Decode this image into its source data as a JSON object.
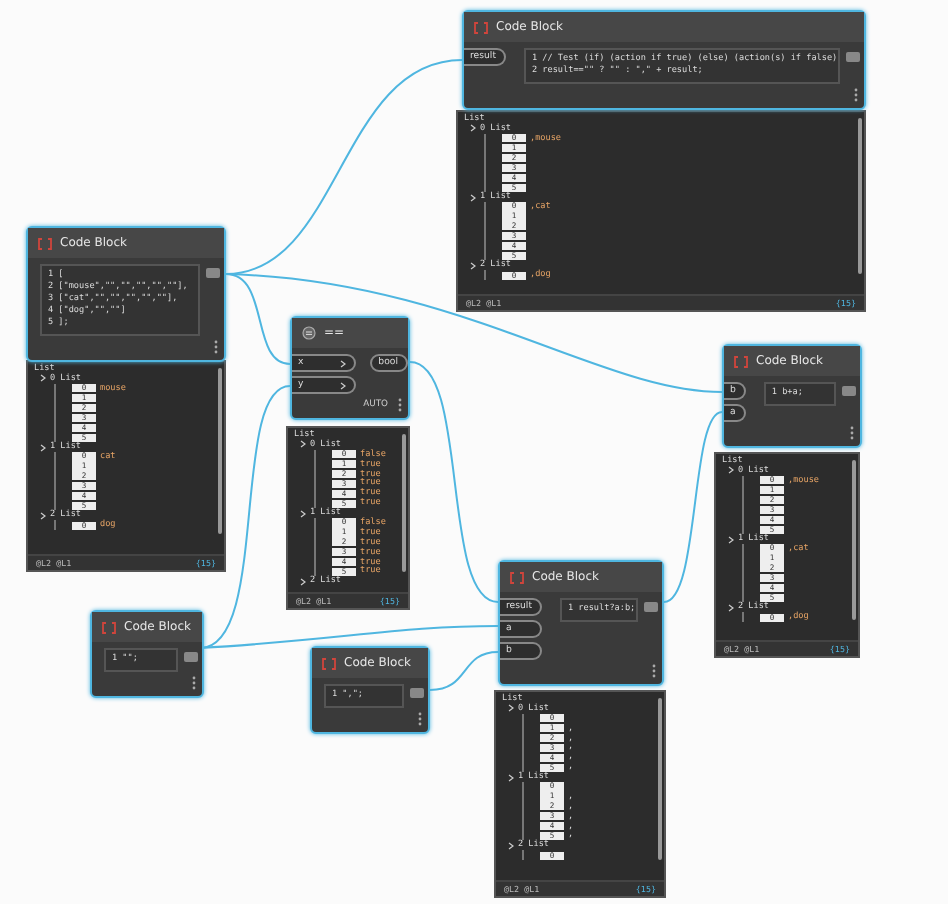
{
  "nodes": [
    {
      "kind": "code",
      "title": "Code Block",
      "selected": true,
      "inputs": [
        "result"
      ],
      "code": [
        "1 // Test (if) (action if true) (else) (action(s) if false)",
        "2 result==\"\" ? \"\" : \",\" + result;"
      ],
      "preview": {
        "header": "List",
        "groups": [
          {
            "label": "0 List",
            "items": [
              {
                "index": "0",
                "value": ",mouse"
              },
              {
                "index": "1",
                "value": ""
              },
              {
                "index": "2",
                "value": ""
              },
              {
                "index": "3",
                "value": ""
              },
              {
                "index": "4",
                "value": ""
              },
              {
                "index": "5",
                "value": ""
              }
            ]
          },
          {
            "label": "1 List",
            "items": [
              {
                "index": "0",
                "value": ",cat"
              },
              {
                "index": "1",
                "value": ""
              },
              {
                "index": "2",
                "value": ""
              },
              {
                "index": "3",
                "value": ""
              },
              {
                "index": "4",
                "value": ""
              },
              {
                "index": "5",
                "value": ""
              }
            ]
          },
          {
            "label": "2 List",
            "items": [
              {
                "index": "0",
                "value": ",dog"
              }
            ]
          }
        ],
        "levels": "@L2 @L1",
        "count": "{15}"
      }
    },
    {
      "kind": "code",
      "title": "Code Block",
      "selected": true,
      "code": [
        "1 [",
        "2 [\"mouse\",\"\",\"\",\"\",\"\",\"\"],",
        "3 [\"cat\",\"\",\"\",\"\",\"\",\"\"],",
        "4 [\"dog\",\"\",\"\"]",
        "5 ];"
      ],
      "preview": {
        "header": "List",
        "groups": [
          {
            "label": "0 List",
            "items": [
              {
                "index": "0",
                "value": "mouse"
              },
              {
                "index": "1",
                "value": ""
              },
              {
                "index": "2",
                "value": ""
              },
              {
                "index": "3",
                "value": ""
              },
              {
                "index": "4",
                "value": ""
              },
              {
                "index": "5",
                "value": ""
              }
            ]
          },
          {
            "label": "1 List",
            "items": [
              {
                "index": "0",
                "value": "cat"
              },
              {
                "index": "1",
                "value": ""
              },
              {
                "index": "2",
                "value": ""
              },
              {
                "index": "3",
                "value": ""
              },
              {
                "index": "4",
                "value": ""
              },
              {
                "index": "5",
                "value": ""
              }
            ]
          },
          {
            "label": "2 List",
            "items": [
              {
                "index": "0",
                "value": "dog"
              }
            ]
          }
        ],
        "levels": "@L2 @L1",
        "count": "{15}"
      }
    },
    {
      "kind": "function",
      "title": "==",
      "selected": true,
      "inputs": [
        "x",
        "y"
      ],
      "output": "bool",
      "lacing": "AUTO",
      "preview": {
        "header": "List",
        "groups": [
          {
            "label": "0 List",
            "items": [
              {
                "index": "0",
                "value": "false"
              },
              {
                "index": "1",
                "value": "true"
              },
              {
                "index": "2",
                "value": "true"
              },
              {
                "index": "3",
                "value": "true"
              },
              {
                "index": "4",
                "value": "true"
              },
              {
                "index": "5",
                "value": "true"
              }
            ]
          },
          {
            "label": "1 List",
            "items": [
              {
                "index": "0",
                "value": "false"
              },
              {
                "index": "1",
                "value": "true"
              },
              {
                "index": "2",
                "value": "true"
              },
              {
                "index": "3",
                "value": "true"
              },
              {
                "index": "4",
                "value": "true"
              },
              {
                "index": "5",
                "value": "true"
              }
            ]
          },
          {
            "label": "2 List"
          }
        ],
        "levels": "@L2 @L1",
        "count": "{15}"
      }
    },
    {
      "kind": "code",
      "title": "Code Block",
      "selected": true,
      "inputs": [
        "b",
        "a"
      ],
      "code": [
        "1 b+a;"
      ],
      "preview": {
        "header": "List",
        "groups": [
          {
            "label": "0 List",
            "items": [
              {
                "index": "0",
                "value": ",mouse"
              },
              {
                "index": "1",
                "value": ""
              },
              {
                "index": "2",
                "value": ""
              },
              {
                "index": "3",
                "value": ""
              },
              {
                "index": "4",
                "value": ""
              },
              {
                "index": "5",
                "value": ""
              }
            ]
          },
          {
            "label": "1 List",
            "items": [
              {
                "index": "0",
                "value": ",cat"
              },
              {
                "index": "1",
                "value": ""
              },
              {
                "index": "2",
                "value": ""
              },
              {
                "index": "3",
                "value": ""
              },
              {
                "index": "4",
                "value": ""
              },
              {
                "index": "5",
                "value": ""
              }
            ]
          },
          {
            "label": "2 List",
            "items": [
              {
                "index": "0",
                "value": ",dog"
              }
            ]
          }
        ],
        "levels": "@L2 @L1",
        "count": "{15}"
      }
    },
    {
      "kind": "code",
      "title": "Code Block",
      "selected": true,
      "inputs": [
        "result",
        "a",
        "b"
      ],
      "code": [
        "1 result?a:b;"
      ],
      "preview": {
        "header": "List",
        "groups": [
          {
            "label": "0 List",
            "items": [
              {
                "index": "0",
                "value": ""
              },
              {
                "index": "1",
                "value": ","
              },
              {
                "index": "2",
                "value": ","
              },
              {
                "index": "3",
                "value": ","
              },
              {
                "index": "4",
                "value": ","
              },
              {
                "index": "5",
                "value": ","
              }
            ]
          },
          {
            "label": "1 List",
            "items": [
              {
                "index": "0",
                "value": ""
              },
              {
                "index": "1",
                "value": ","
              },
              {
                "index": "2",
                "value": ","
              },
              {
                "index": "3",
                "value": ","
              },
              {
                "index": "4",
                "value": ","
              },
              {
                "index": "5",
                "value": ","
              }
            ]
          },
          {
            "label": "2 List",
            "items": [
              {
                "index": "0",
                "value": ""
              }
            ]
          }
        ],
        "levels": "@L2 @L1",
        "count": "{15}"
      }
    },
    {
      "kind": "code",
      "title": "Code Block",
      "selected": true,
      "code": [
        "1 \"\";"
      ]
    },
    {
      "kind": "code",
      "title": "Code Block",
      "selected": true,
      "code": [
        "1 \",\";"
      ]
    }
  ]
}
